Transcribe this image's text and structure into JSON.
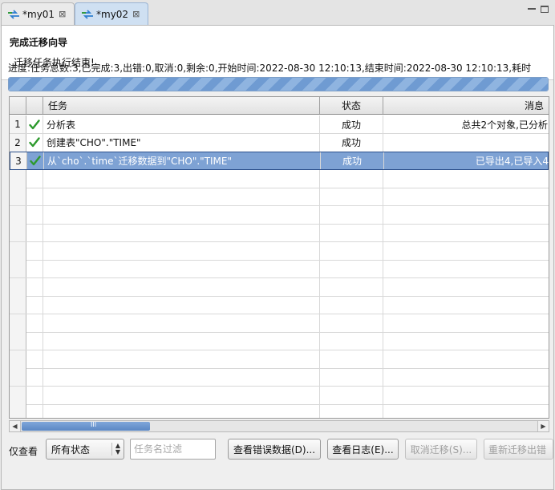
{
  "tabs": [
    {
      "label": "*my01",
      "close": "⊠"
    },
    {
      "label": "*my02",
      "close": "⊠"
    }
  ],
  "header": {
    "title": "完成迁移向导",
    "description": "迁移任务执行结束!"
  },
  "progress": {
    "text": "进度:任务总数:3,已完成:3,出错:0,取消:0,剩余:0,开始时间:2022-08-30 12:10:13,结束时间:2022-08-30 12:10:13,耗时",
    "fraction": 1.0
  },
  "table": {
    "columns": [
      "",
      "",
      "任务",
      "状态",
      "消息"
    ],
    "rows": [
      {
        "num": "1",
        "task": "分析表",
        "status": "成功",
        "message": "总共2个对象,已分析"
      },
      {
        "num": "2",
        "task": "创建表\"CHO\".\"TIME\"",
        "status": "成功",
        "message": ""
      },
      {
        "num": "3",
        "task": "从`cho`.`time`迁移数据到\"CHO\".\"TIME\"",
        "status": "成功",
        "message": "已导出4,已导入4"
      }
    ],
    "selected_row": 3,
    "check_color": "#2e9a2e"
  },
  "scrollbar": {
    "left": "◀",
    "right": "▶",
    "grip": "III"
  },
  "bottom": {
    "only_view_label": "仅查看",
    "status_select": "所有状态",
    "filter_placeholder": "任务名过滤",
    "buttons": {
      "view_error_data": "查看错误数据(D)...",
      "view_log": "查看日志(E)...",
      "cancel_migration": "取消迁移(S)...",
      "remigrate_errors": "重新迁移出错"
    }
  },
  "colors": {
    "selection": "#7ea2d4",
    "progress": "#6f9bd2"
  }
}
